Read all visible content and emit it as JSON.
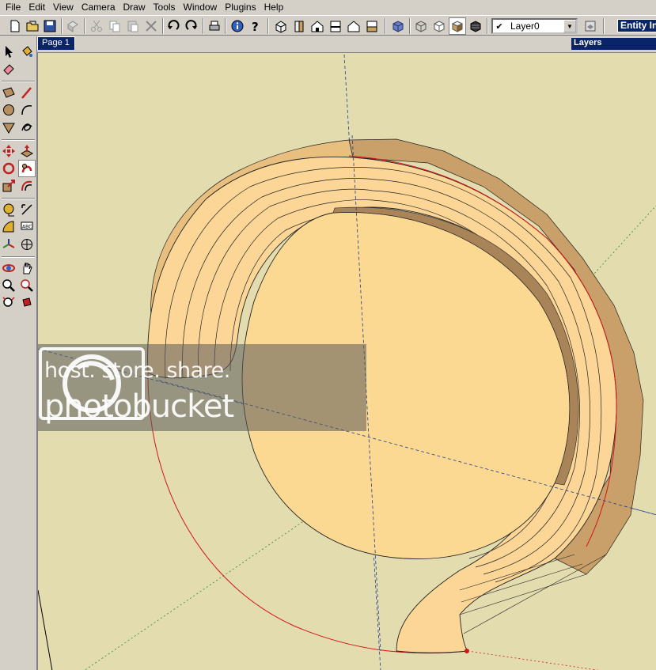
{
  "menu": {
    "items": [
      "File",
      "Edit",
      "View",
      "Camera",
      "Draw",
      "Tools",
      "Window",
      "Plugins",
      "Help"
    ]
  },
  "toolbar": {
    "buttons": [
      {
        "name": "new-icon"
      },
      {
        "name": "open-icon"
      },
      {
        "name": "save-icon"
      },
      {
        "name": "make-component-icon"
      },
      {
        "name": "cut-icon"
      },
      {
        "name": "copy-icon"
      },
      {
        "name": "paste-icon"
      },
      {
        "name": "erase-icon"
      },
      {
        "name": "undo-icon"
      },
      {
        "name": "redo-icon"
      },
      {
        "name": "print-icon"
      },
      {
        "name": "model-info-icon"
      },
      {
        "name": "help-icon"
      },
      {
        "name": "iso-view-icon"
      },
      {
        "name": "top-view-icon"
      },
      {
        "name": "front-view-icon"
      },
      {
        "name": "right-view-icon"
      },
      {
        "name": "back-view-icon"
      },
      {
        "name": "left-view-icon"
      },
      {
        "name": "xray-icon"
      },
      {
        "name": "wireframe-icon"
      },
      {
        "name": "hidden-line-icon"
      },
      {
        "name": "shaded-icon"
      },
      {
        "name": "shaded-textures-icon"
      }
    ],
    "layer_select": {
      "check": "✔",
      "value": "Layer0"
    },
    "layer_manager_icon": "layer-manager-icon",
    "entity_info_label": "Entity Inf"
  },
  "tabs": {
    "page_tab": "Page 1",
    "layers_title": "Layers"
  },
  "left_tools": [
    {
      "name": "select-icon"
    },
    {
      "name": "paint-bucket-icon"
    },
    {
      "name": "eraser-icon"
    },
    {
      "name": "rectangle-icon"
    },
    {
      "name": "line-icon"
    },
    {
      "name": "circle-icon"
    },
    {
      "name": "arc-icon"
    },
    {
      "name": "polygon-icon"
    },
    {
      "name": "freehand-icon"
    },
    {
      "name": "move-icon"
    },
    {
      "name": "push-pull-icon"
    },
    {
      "name": "rotate-icon"
    },
    {
      "name": "follow-me-icon"
    },
    {
      "name": "scale-icon"
    },
    {
      "name": "offset-icon"
    },
    {
      "name": "tape-measure-icon"
    },
    {
      "name": "dimension-icon"
    },
    {
      "name": "protractor-icon"
    },
    {
      "name": "text-icon"
    },
    {
      "name": "axes-icon"
    },
    {
      "name": "3d-text-icon"
    },
    {
      "name": "orbit-icon"
    },
    {
      "name": "pan-icon"
    },
    {
      "name": "zoom-icon"
    },
    {
      "name": "zoom-window-icon"
    },
    {
      "name": "zoom-extents-icon"
    },
    {
      "name": "previous-view-icon"
    }
  ],
  "watermark": {
    "line1": "host. store. share.",
    "line2": "photobucket"
  },
  "colors": {
    "canvas_bg": "#e3dcaf",
    "face_light": "#fbd696",
    "face_mid": "#e9bf7f",
    "face_dark": "#c9a06a",
    "edge_red": "#d0161b",
    "axis_blue": "#1f3c8c",
    "axis_green": "#2d8a2d",
    "title_bar": "#0a246a"
  }
}
